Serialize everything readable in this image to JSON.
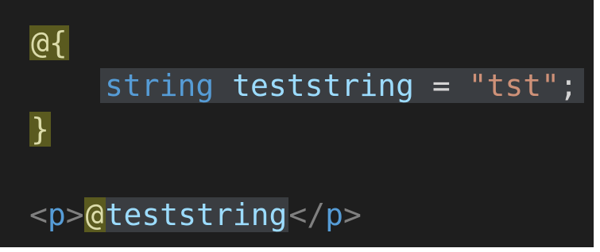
{
  "colors": {
    "background": "#1e1e1e",
    "razor_highlight": "#5a5a1f",
    "block_highlight": "#3a3d41",
    "keyword": "#569cd6",
    "identifier": "#9cdcfe",
    "string": "#ce9178",
    "tag_bracket": "#808080"
  },
  "code": {
    "line1": {
      "razor_open": "@{"
    },
    "line2": {
      "keyword": "string",
      "identifier": "teststring",
      "operator": "=",
      "string_literal": "\"tst\"",
      "terminator": ";"
    },
    "line3": {
      "razor_close": "}"
    },
    "line4": {
      "open_lt": "<",
      "open_tag": "p",
      "open_gt": ">",
      "razor_at": "@",
      "variable": "teststring",
      "close_lt": "</",
      "close_tag": "p",
      "close_gt": ">"
    }
  }
}
